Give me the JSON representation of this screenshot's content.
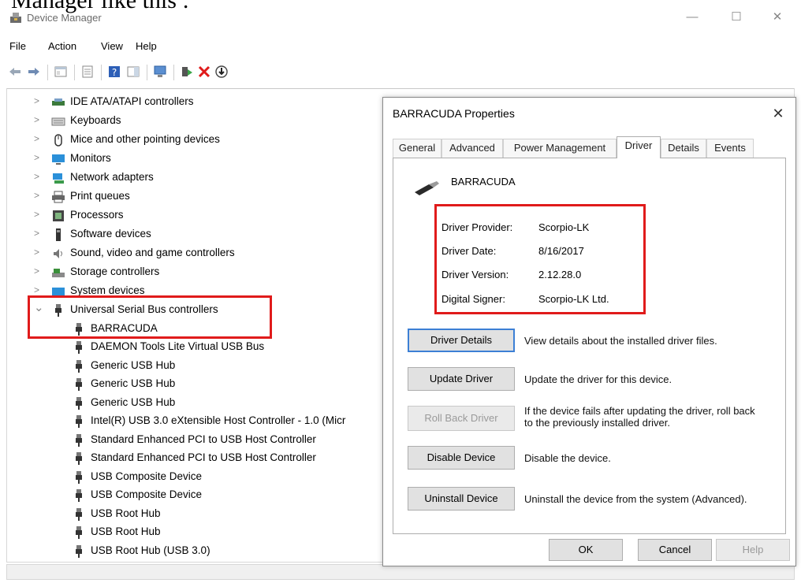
{
  "caption": "Manager like this :",
  "window": {
    "title": "Device Manager",
    "min_glyph": "—",
    "max_glyph": "☐",
    "close_glyph": "✕"
  },
  "menu": [
    "File",
    "Action",
    "View",
    "Help"
  ],
  "tree": {
    "collapse_glyph": ">",
    "expand_glyph": "⌄",
    "categories": [
      {
        "label": "IDE ATA/ATAPI controllers",
        "icon": "ide-controller-icon"
      },
      {
        "label": "Keyboards",
        "icon": "keyboard-icon"
      },
      {
        "label": "Mice and other pointing devices",
        "icon": "mouse-icon"
      },
      {
        "label": "Monitors",
        "icon": "monitor-icon"
      },
      {
        "label": "Network adapters",
        "icon": "network-adapter-icon"
      },
      {
        "label": "Print queues",
        "icon": "printer-icon"
      },
      {
        "label": "Processors",
        "icon": "processor-icon"
      },
      {
        "label": "Software devices",
        "icon": "software-device-icon"
      },
      {
        "label": "Sound, video and game controllers",
        "icon": "speaker-icon"
      },
      {
        "label": "Storage controllers",
        "icon": "storage-controller-icon"
      },
      {
        "label": "System devices",
        "icon": "system-device-icon"
      }
    ],
    "expanded_category": {
      "label": "Universal Serial Bus controllers",
      "icon": "usb-icon"
    },
    "usb_devices": [
      "BARRACUDA",
      "DAEMON Tools Lite Virtual USB Bus",
      "Generic USB Hub",
      "Generic USB Hub",
      "Generic USB Hub",
      "Intel(R) USB 3.0 eXtensible Host Controller - 1.0 (Micr",
      "Standard Enhanced PCI to USB Host Controller",
      "Standard Enhanced PCI to USB Host Controller",
      "USB Composite Device",
      "USB Composite Device",
      "USB Root Hub",
      "USB Root Hub",
      "USB Root Hub (USB 3.0)"
    ]
  },
  "dialog": {
    "title": "BARRACUDA Properties",
    "close_glyph": "✕",
    "tabs": [
      "General",
      "Advanced",
      "Power Management",
      "Driver",
      "Details",
      "Events"
    ],
    "active_tab": "Driver",
    "device_name": "BARRACUDA",
    "properties": [
      {
        "label": "Driver Provider:",
        "value": "Scorpio-LK"
      },
      {
        "label": "Driver Date:",
        "value": "8/16/2017"
      },
      {
        "label": "Driver Version:",
        "value": "2.12.28.0"
      },
      {
        "label": "Digital Signer:",
        "value": "Scorpio-LK Ltd."
      }
    ],
    "actions": [
      {
        "label": "Driver Details",
        "desc": "View details about the installed driver files."
      },
      {
        "label": "Update Driver",
        "desc": "Update the driver for this device."
      },
      {
        "label": "Roll Back Driver",
        "desc": "If the device fails after updating the driver, roll back to the previously installed driver."
      },
      {
        "label": "Disable Device",
        "desc": "Disable the device."
      },
      {
        "label": "Uninstall Device",
        "desc": "Uninstall the device from the system (Advanced)."
      }
    ],
    "footer": {
      "ok": "OK",
      "cancel": "Cancel",
      "help": "Help"
    }
  },
  "colors": {
    "highlight": "#e01b1b",
    "focus": "#3c7fd5"
  }
}
